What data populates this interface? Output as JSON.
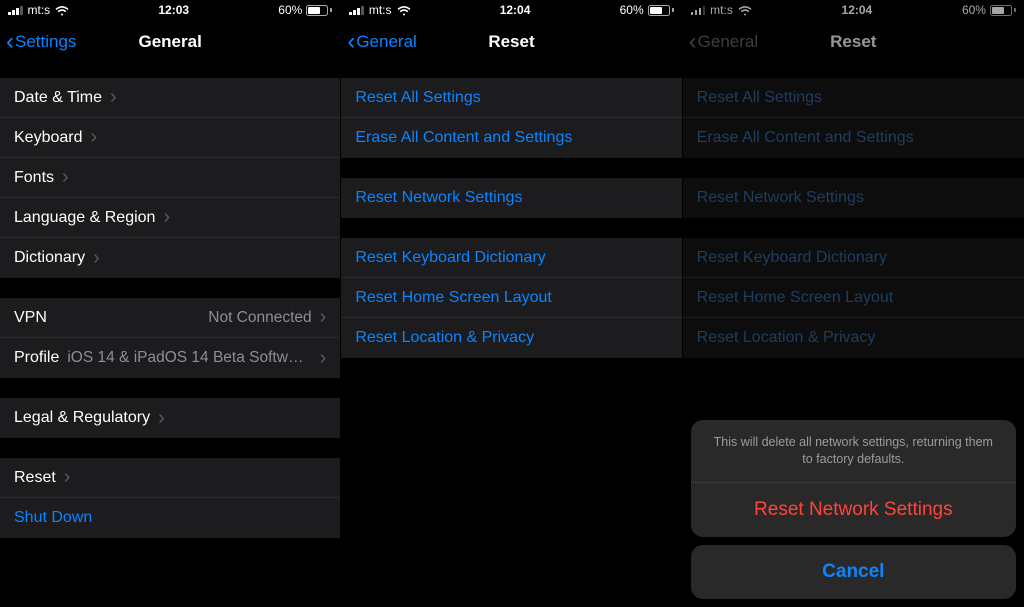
{
  "status": {
    "carrier": "mt:s",
    "battery_pct": "60%"
  },
  "screen1": {
    "time": "12:03",
    "back": "Settings",
    "title": "General",
    "groups": [
      [
        {
          "label": "Date & Time"
        },
        {
          "label": "Keyboard"
        },
        {
          "label": "Fonts"
        },
        {
          "label": "Language & Region"
        },
        {
          "label": "Dictionary"
        }
      ],
      [
        {
          "label": "VPN",
          "value": "Not Connected"
        },
        {
          "label": "Profile",
          "value": "iOS 14 & iPadOS 14 Beta Softwar..."
        }
      ],
      [
        {
          "label": "Legal & Regulatory"
        }
      ],
      [
        {
          "label": "Reset"
        },
        {
          "label": "Shut Down",
          "link": true
        }
      ]
    ]
  },
  "screen2": {
    "time": "12:04",
    "back": "General",
    "title": "Reset",
    "groups": [
      [
        {
          "label": "Reset All Settings"
        },
        {
          "label": "Erase All Content and Settings"
        }
      ],
      [
        {
          "label": "Reset Network Settings"
        }
      ],
      [
        {
          "label": "Reset Keyboard Dictionary"
        },
        {
          "label": "Reset Home Screen Layout"
        },
        {
          "label": "Reset Location & Privacy"
        }
      ]
    ]
  },
  "screen3": {
    "time": "12:04",
    "back": "General",
    "title": "Reset",
    "sheet": {
      "message": "This will delete all network settings, returning them to factory defaults.",
      "destructive": "Reset Network Settings",
      "cancel": "Cancel"
    }
  }
}
